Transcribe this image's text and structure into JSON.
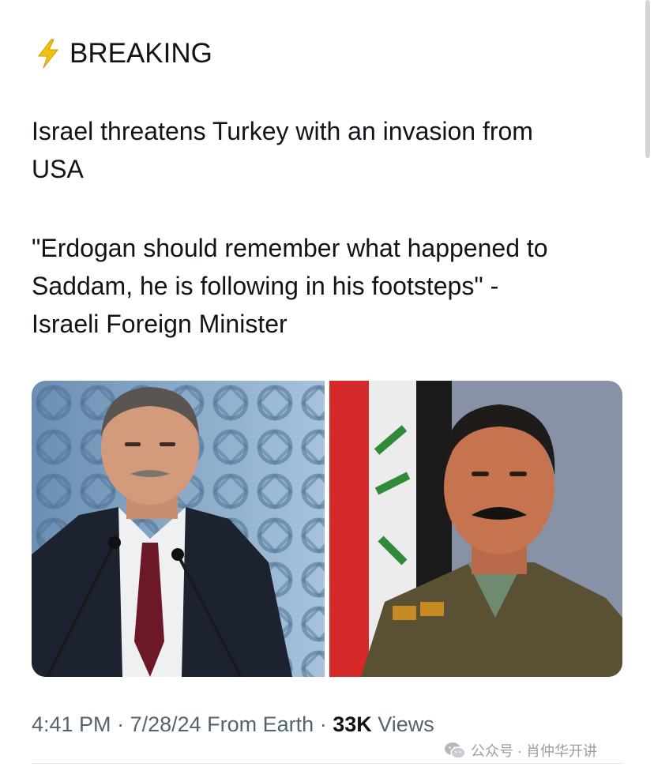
{
  "post": {
    "label": "BREAKING",
    "label_icon": "lightning-icon",
    "lines": [
      "Israel threatens Turkey with an invasion from",
      "USA",
      "\"Erdogan should remember what happened to",
      "Saddam, he is following in his footsteps\" -",
      "Israeli Foreign Minister"
    ],
    "time": "4:41 PM",
    "sep1": " · ",
    "date": "7/28/24",
    "source": " From Earth",
    "sep2": " · ",
    "views_count": "33K",
    "views_label": " Views"
  },
  "images": [
    {
      "icon": "photo-erdogan"
    },
    {
      "icon": "photo-saddam"
    }
  ],
  "watermark": {
    "icon": "wechat-icon",
    "text": "公众号 · 肖仲华开讲"
  },
  "colors": {
    "text": "#0f1419",
    "secondary": "#536471",
    "bolt": "#f4c20d",
    "divider": "#e1e6ea"
  }
}
